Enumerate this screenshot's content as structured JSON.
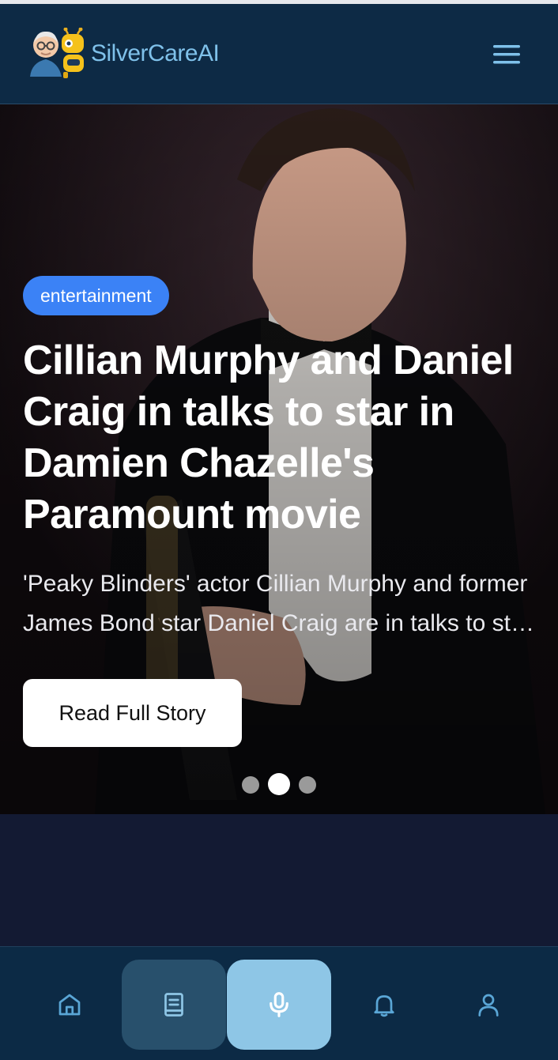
{
  "header": {
    "brand": "SilverCareAI",
    "logo_icon": "senior-and-robot-logo",
    "menu_icon": "hamburger-menu-icon"
  },
  "hero": {
    "category": "entertainment",
    "headline": "Cillian Murphy and Daniel Craig in talks to star in Damien Chazelle's Paramount movie",
    "summary": "'Peaky Blinders' actor Cillian Murphy and former James Bond star Daniel Craig are in talks to star in Damien Chazelle's Paramount movie",
    "cta": "Read Full Story",
    "carousel": {
      "slides": 3,
      "active_index": 1
    }
  },
  "colors": {
    "header_bg": "#0d2a45",
    "brand_text": "#7fc1ea",
    "badge_bg": "#3b82f6",
    "mic_active_bg": "#8ec6e6",
    "book_active_bg": "#28506c"
  },
  "bottom_nav": [
    {
      "icon": "home-icon",
      "active": false
    },
    {
      "icon": "book-icon",
      "active": true
    },
    {
      "icon": "microphone-icon",
      "active": true
    },
    {
      "icon": "bell-icon",
      "active": false
    },
    {
      "icon": "user-icon",
      "active": false
    }
  ]
}
